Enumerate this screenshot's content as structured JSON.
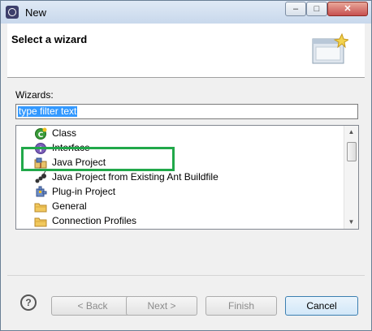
{
  "window": {
    "title": "New",
    "controls": {
      "minimize": "‒",
      "maximize": "□",
      "close": "✕"
    }
  },
  "header": {
    "title": "Select a wizard"
  },
  "filter": {
    "label": "Wizards:",
    "value": "type filter text"
  },
  "tree": {
    "items": [
      {
        "label": "Class",
        "icon": "class-icon"
      },
      {
        "label": "Interface",
        "icon": "interface-icon"
      },
      {
        "label": "Java Project",
        "icon": "java-project-icon"
      },
      {
        "label": "Java Project from Existing Ant Buildfile",
        "icon": "ant-buildfile-icon"
      },
      {
        "label": "Plug-in Project",
        "icon": "plugin-project-icon"
      },
      {
        "label": "General",
        "icon": "folder-icon"
      },
      {
        "label": "Connection Profiles",
        "icon": "folder-icon"
      }
    ]
  },
  "buttons": {
    "help": "?",
    "back": "< Back",
    "next": "Next >",
    "finish": "Finish",
    "cancel": "Cancel"
  },
  "colors": {
    "highlight": "#21a84a",
    "selection": "#3399ff"
  }
}
